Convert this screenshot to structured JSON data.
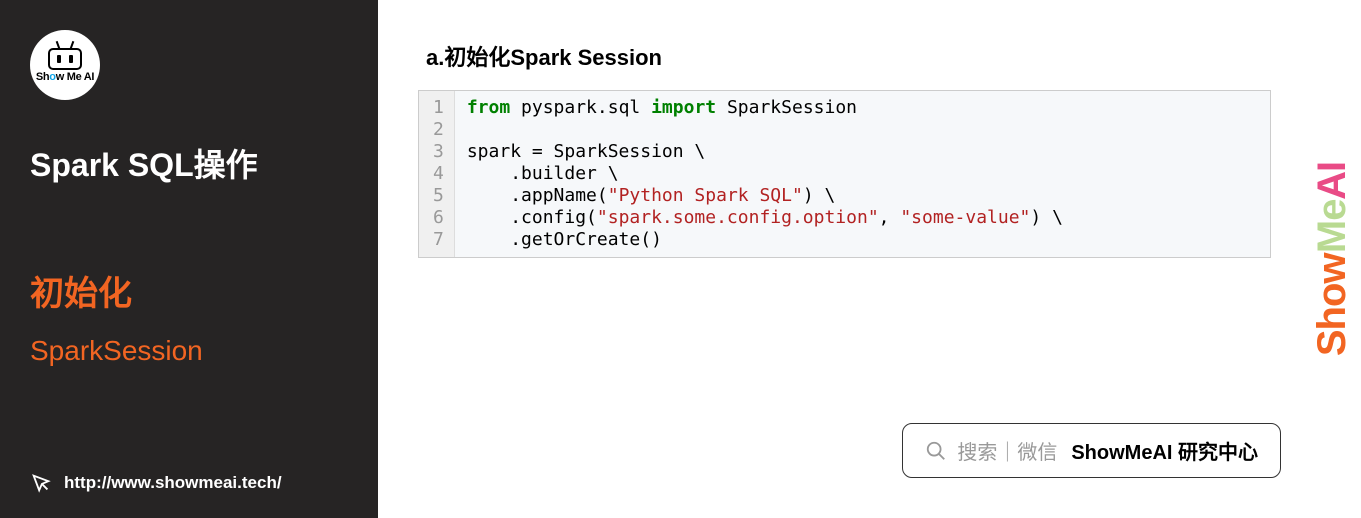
{
  "sidebar": {
    "logo_text_pre": "Sh",
    "logo_text_o": "o",
    "logo_text_post": "w Me AI",
    "title": "Spark SQL操作",
    "section": "初始化",
    "subsection": "SparkSession",
    "url": "http://www.showmeai.tech/"
  },
  "main": {
    "heading": "a.初始化Spark Session",
    "code": {
      "line_numbers": [
        "1",
        "2",
        "3",
        "4",
        "5",
        "6",
        "7"
      ],
      "l1_kw1": "from",
      "l1_mod": " pyspark.sql ",
      "l1_kw2": "import",
      "l1_cls": " SparkSession",
      "l3": "spark = SparkSession \\",
      "l4": "    .builder \\",
      "l5_pre": "    .appName(",
      "l5_str": "\"Python Spark SQL\"",
      "l5_post": ") \\",
      "l6_pre": "    .config(",
      "l6_str1": "\"spark.some.config.option\"",
      "l6_mid": ", ",
      "l6_str2": "\"some-value\"",
      "l6_post": ") \\",
      "l7": "    .getOrCreate()"
    }
  },
  "watermark": {
    "p1": "Show",
    "p2": "Me",
    "p3": "AI"
  },
  "search": {
    "hint": "搜索｜微信",
    "bold": "ShowMeAI 研究中心"
  }
}
